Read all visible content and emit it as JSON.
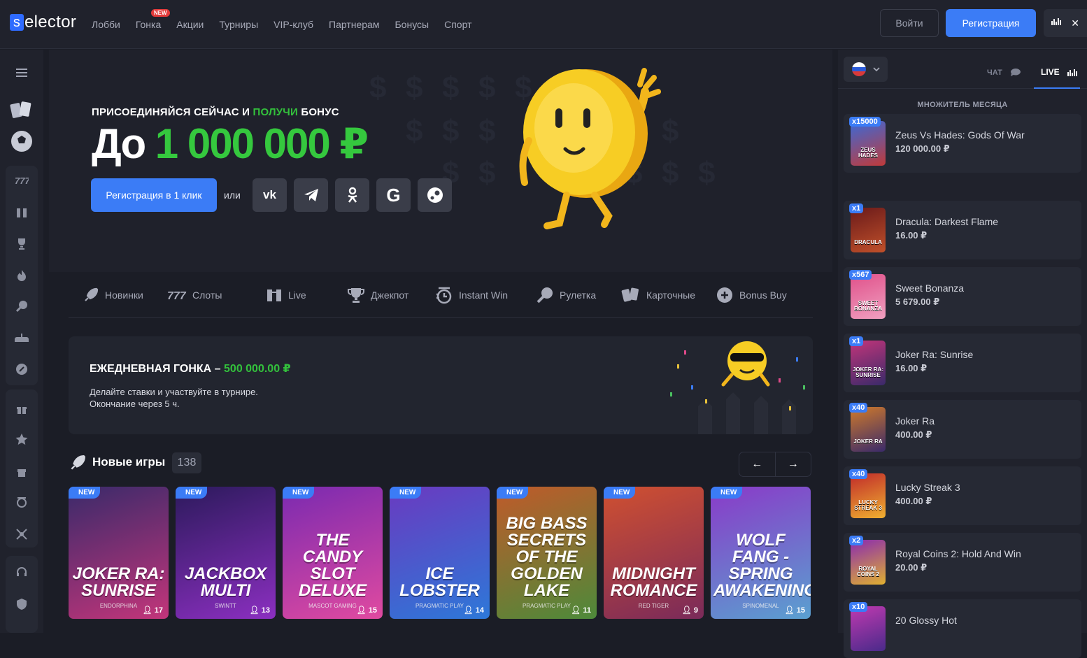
{
  "brand": {
    "logo_letter": "s",
    "logo_text": "elector",
    "accent": "#3b7cf6",
    "green": "#35c83e"
  },
  "nav": [
    {
      "label": "Лобби"
    },
    {
      "label": "Гонка",
      "badge": "NEW"
    },
    {
      "label": "Акции"
    },
    {
      "label": "Турниры"
    },
    {
      "label": "VIP-клуб"
    },
    {
      "label": "Партнерам"
    },
    {
      "label": "Бонусы"
    },
    {
      "label": "Спорт"
    }
  ],
  "header": {
    "login": "Войти",
    "register": "Регистрация",
    "close": "✕"
  },
  "hero": {
    "kicker_a": "ПРИСОЕДИНЯЙСЯ СЕЙЧАС И ",
    "kicker_b": "ПОЛУЧИ",
    "kicker_c": " БОНУС",
    "big_a": "До ",
    "big_b": "1 000 000 ₽",
    "register_one_click": "Регистрация в 1 клик",
    "or": "или"
  },
  "categories": [
    {
      "label": "Новинки",
      "icon": "rocket-icon"
    },
    {
      "label": "Слоты",
      "icon": "slots-icon"
    },
    {
      "label": "Live",
      "icon": "cards-live-icon"
    },
    {
      "label": "Джекпот",
      "icon": "trophy-icon"
    },
    {
      "label": "Instant Win",
      "icon": "instant-icon"
    },
    {
      "label": "Рулетка",
      "icon": "roulette-icon"
    },
    {
      "label": "Карточные",
      "icon": "cards-icon"
    },
    {
      "label": "Bonus Buy",
      "icon": "bonus-buy-icon"
    }
  ],
  "race": {
    "title_a": "ЕЖЕДНЕВНАЯ ГОНКА – ",
    "title_b": "500 000.00 ₽",
    "line1": "Делайте ставки и участвуйте в турнире.",
    "line2": "Окончание через 5 ч."
  },
  "new_games": {
    "title": "Новые игры",
    "count": "138",
    "prev": "←",
    "next": "→",
    "items": [
      {
        "badge": "NEW",
        "title": "JOKER RA: SUNRISE",
        "provider": "ENDORPHINA",
        "players": "17",
        "color1": "#c2357a",
        "color2": "#3a2a6a"
      },
      {
        "badge": "NEW",
        "title": "JACKBOX MULTI",
        "provider": "SWINTT",
        "players": "13",
        "color1": "#8b2fc0",
        "color2": "#2c1a5c"
      },
      {
        "badge": "NEW",
        "title": "THE CANDY SLOT DELUXE",
        "provider": "MASCOT GAMING",
        "players": "15",
        "color1": "#e04aa0",
        "color2": "#7a2ab0"
      },
      {
        "badge": "NEW",
        "title": "ICE LOBSTER",
        "provider": "PRAGMATIC PLAY",
        "players": "14",
        "color1": "#2d78d8",
        "color2": "#6a3ac0"
      },
      {
        "badge": "NEW",
        "title": "BIG BASS SECRETS OF THE GOLDEN LAKE",
        "provider": "PRAGMATIC PLAY",
        "players": "11",
        "color1": "#4d8a3a",
        "color2": "#c05a2a"
      },
      {
        "badge": "NEW",
        "title": "MIDNIGHT ROMANCE",
        "provider": "RED TIGER",
        "players": "9",
        "color1": "#7a2a5a",
        "color2": "#d05030"
      },
      {
        "badge": "NEW",
        "title": "WOLF FANG - SPRING AWAKENING",
        "provider": "SPINOMENAL",
        "players": "15",
        "color1": "#5aa0d0",
        "color2": "#8a3ac8"
      }
    ]
  },
  "right_panel": {
    "chat": "ЧАТ",
    "live": "LIVE",
    "month_multiplier": "МНОЖИТЕЛЬ МЕСЯЦА",
    "items": [
      {
        "mult": "x15000",
        "name": "Zeus Vs Hades: Gods Of War",
        "amount": "120 000.00 ₽",
        "thumb": "ZEUS HADES",
        "c1": "#3a6ad8",
        "c2": "#c03a3a"
      },
      {
        "mult": "x1",
        "name": "Dracula: Darkest Flame",
        "amount": "16.00 ₽",
        "thumb": "DRACULA",
        "c1": "#6a1a1a",
        "c2": "#c0502a"
      },
      {
        "mult": "x567",
        "name": "Sweet Bonanza",
        "amount": "5 679.00 ₽",
        "thumb": "SWEET BONANZA",
        "c1": "#e0508a",
        "c2": "#f0a0c0"
      },
      {
        "mult": "x1",
        "name": "Joker Ra: Sunrise",
        "amount": "16.00 ₽",
        "thumb": "JOKER RA: SUNRISE",
        "c1": "#c2357a",
        "c2": "#3a2a6a"
      },
      {
        "mult": "x40",
        "name": "Joker Ra",
        "amount": "400.00 ₽",
        "thumb": "JOKER RA",
        "c1": "#d07a2a",
        "c2": "#3a2a6a"
      },
      {
        "mult": "x40",
        "name": "Lucky Streak 3",
        "amount": "400.00 ₽",
        "thumb": "LUCKY STREAK 3",
        "c1": "#c02a2a",
        "c2": "#f0b030"
      },
      {
        "mult": "x2",
        "name": "Royal Coins 2: Hold And Win",
        "amount": "20.00 ₽",
        "thumb": "ROYAL COINS 2",
        "c1": "#8a2ab0",
        "c2": "#e0b030"
      },
      {
        "mult": "x10",
        "name": "20 Glossy Hot",
        "amount": "",
        "thumb": "",
        "c1": "#c03ab0",
        "c2": "#4a2a8a"
      }
    ]
  }
}
